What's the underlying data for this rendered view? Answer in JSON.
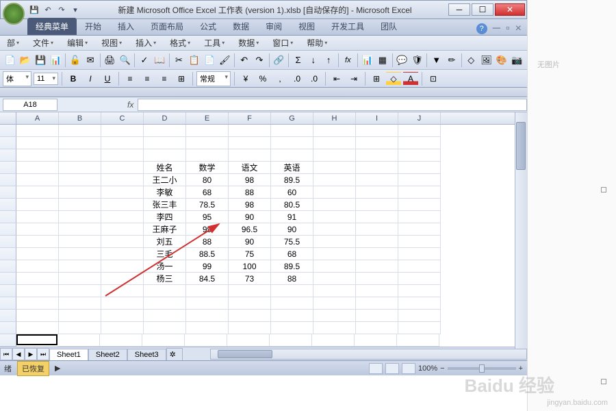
{
  "title": "新建 Microsoft Office Excel 工作表 (version 1).xlsb [自动保存的] - Microsoft Excel",
  "tabs": [
    "经典菜单",
    "开始",
    "插入",
    "页面布局",
    "公式",
    "数据",
    "审阅",
    "视图",
    "开发工具",
    "团队"
  ],
  "active_tab": 0,
  "menus": [
    "部",
    "文件",
    "编辑",
    "视图",
    "插入",
    "格式",
    "工具",
    "数据",
    "窗口",
    "帮助"
  ],
  "format": {
    "font": "体",
    "size": "11",
    "style_label": "常规"
  },
  "name_box": "A18",
  "fx_label": "fx",
  "columns": [
    "A",
    "B",
    "C",
    "D",
    "E",
    "F",
    "G",
    "H",
    "I",
    "J"
  ],
  "table": {
    "startCol": 4,
    "startRow": 4,
    "headers": [
      "姓名",
      "数学",
      "语文",
      "英语"
    ],
    "rows": [
      [
        "王二小",
        "80",
        "98",
        "89.5"
      ],
      [
        "李敏",
        "68",
        "88",
        "60"
      ],
      [
        "张三丰",
        "78.5",
        "98",
        "80.5"
      ],
      [
        "李四",
        "95",
        "90",
        "91"
      ],
      [
        "王麻子",
        "99",
        "96.5",
        "90"
      ],
      [
        "刘五",
        "88",
        "90",
        "75.5"
      ],
      [
        "三毛",
        "88.5",
        "75",
        "68"
      ],
      [
        "汤一",
        "99",
        "100",
        "89.5"
      ],
      [
        "杨三",
        "84.5",
        "73",
        "88"
      ]
    ]
  },
  "sheets": [
    "Sheet1",
    "Sheet2",
    "Sheet3"
  ],
  "active_sheet": 0,
  "status": {
    "ready": "绪",
    "saved": "已恢复",
    "zoom": "100%"
  },
  "watermark": "Baidu 经验",
  "watermark_sub": "jingyan.baidu.com",
  "side_label": "无图片"
}
